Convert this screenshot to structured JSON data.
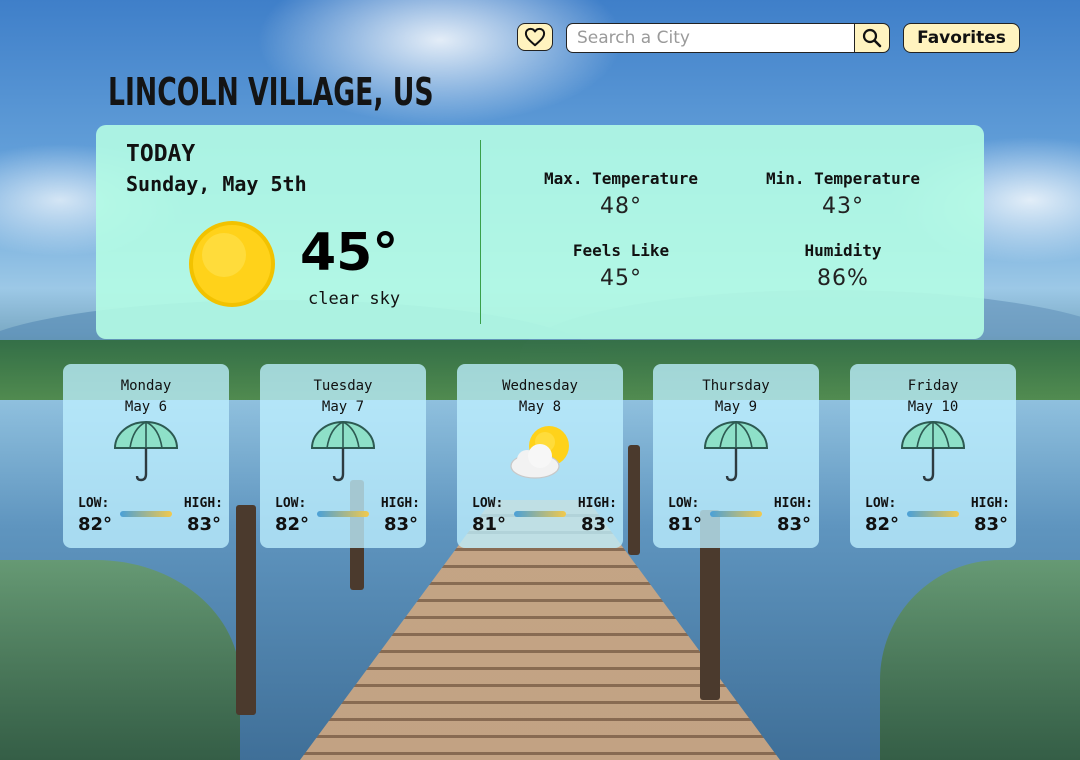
{
  "city": "LINCOLN VILLAGE, US",
  "search": {
    "placeholder": "Search a City"
  },
  "header": {
    "favorites_label": "Favorites"
  },
  "today": {
    "label": "TODAY",
    "date": "Sunday, May 5th",
    "temperature": "45°",
    "condition": "clear sky",
    "icon": "sun-icon",
    "stats": {
      "max_label": "Max. Temperature",
      "max_value": "48°",
      "min_label": "Min. Temperature",
      "min_value": "43°",
      "feels_label": "Feels Like",
      "feels_value": "45°",
      "humidity_label": "Humidity",
      "humidity_value": "86%"
    }
  },
  "forecast_labels": {
    "low": "LOW:",
    "high": "HIGH:"
  },
  "forecast": [
    {
      "day": "Monday",
      "date": "May 6",
      "icon": "umbrella-icon",
      "low": "82°",
      "high": "83°"
    },
    {
      "day": "Tuesday",
      "date": "May 7",
      "icon": "umbrella-icon",
      "low": "82°",
      "high": "83°"
    },
    {
      "day": "Wednesday",
      "date": "May 8",
      "icon": "partly-cloudy-icon",
      "low": "81°",
      "high": "83°"
    },
    {
      "day": "Thursday",
      "date": "May 9",
      "icon": "umbrella-icon",
      "low": "81°",
      "high": "83°"
    },
    {
      "day": "Friday",
      "date": "May 10",
      "icon": "umbrella-icon",
      "low": "82°",
      "high": "83°"
    }
  ],
  "colors": {
    "panel": "#b4fce4",
    "card": "#bef0ff",
    "button": "#fff3bf",
    "divider": "#3aa04a"
  }
}
